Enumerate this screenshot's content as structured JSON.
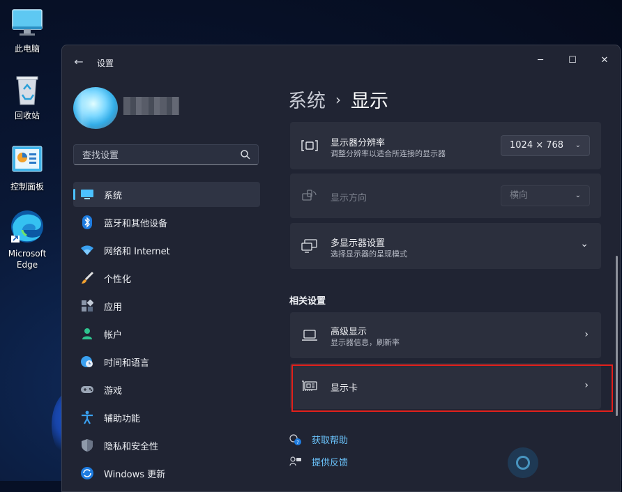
{
  "desktop": {
    "icons": [
      {
        "label": "此电脑"
      },
      {
        "label": "回收站"
      },
      {
        "label": "控制面板"
      },
      {
        "label": "Microsoft Edge"
      }
    ]
  },
  "window": {
    "title": "设置",
    "controls": {
      "minimize": "─",
      "maximize": "☐",
      "close": "✕"
    },
    "back": "←"
  },
  "sidebar": {
    "search_placeholder": "查找设置",
    "items": [
      {
        "label": "系统",
        "icon": "monitor-icon",
        "active": true
      },
      {
        "label": "蓝牙和其他设备",
        "icon": "bluetooth-icon"
      },
      {
        "label": "网络和 Internet",
        "icon": "wifi-icon"
      },
      {
        "label": "个性化",
        "icon": "brush-icon"
      },
      {
        "label": "应用",
        "icon": "apps-icon"
      },
      {
        "label": "帐户",
        "icon": "person-icon"
      },
      {
        "label": "时间和语言",
        "icon": "globe-clock-icon"
      },
      {
        "label": "游戏",
        "icon": "gamepad-icon"
      },
      {
        "label": "辅助功能",
        "icon": "accessibility-icon"
      },
      {
        "label": "隐私和安全性",
        "icon": "shield-icon"
      },
      {
        "label": "Windows 更新",
        "icon": "update-icon"
      }
    ]
  },
  "main": {
    "breadcrumb": {
      "root": "系统",
      "sep": "›",
      "current": "显示"
    },
    "cards": {
      "resolution": {
        "title": "显示器分辨率",
        "subtitle": "调整分辨率以适合所连接的显示器",
        "value": "1024 × 768"
      },
      "orientation": {
        "title": "显示方向",
        "value": "横向"
      },
      "multi": {
        "title": "多显示器设置",
        "subtitle": "选择显示器的呈现模式"
      }
    },
    "related_heading": "相关设置",
    "related": {
      "advanced": {
        "title": "高级显示",
        "subtitle": "显示器信息，刷新率"
      },
      "graphics": {
        "title": "显示卡"
      }
    },
    "links": {
      "help": "获取帮助",
      "feedback": "提供反馈"
    }
  },
  "colors": {
    "accent": "#4cc2ff",
    "link": "#6cc6ff",
    "highlight": "#e3201b"
  }
}
